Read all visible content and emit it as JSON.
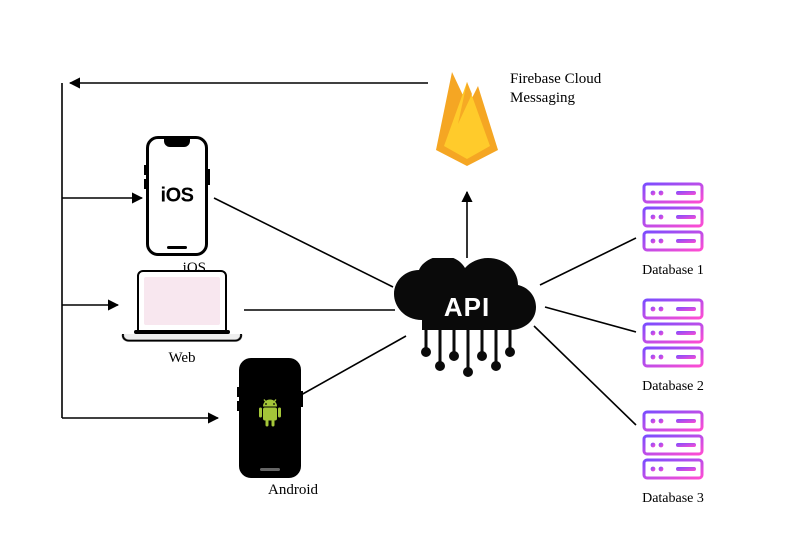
{
  "clients": {
    "ios": {
      "label": "iOS",
      "screen_text": "iOS"
    },
    "web": {
      "label": "Web"
    },
    "android": {
      "label": "Android"
    }
  },
  "api": {
    "label": "API"
  },
  "firebase": {
    "label": "Firebase Cloud\nMessaging"
  },
  "databases": [
    "Database 1",
    "Database 2",
    "Database 3"
  ],
  "colors": {
    "cloud": "#0a0a0a",
    "firebase_outer": "#f5a623",
    "firebase_inner": "#ffcb2b",
    "server_a": "#7b4dff",
    "server_b": "#ff4dd2"
  }
}
